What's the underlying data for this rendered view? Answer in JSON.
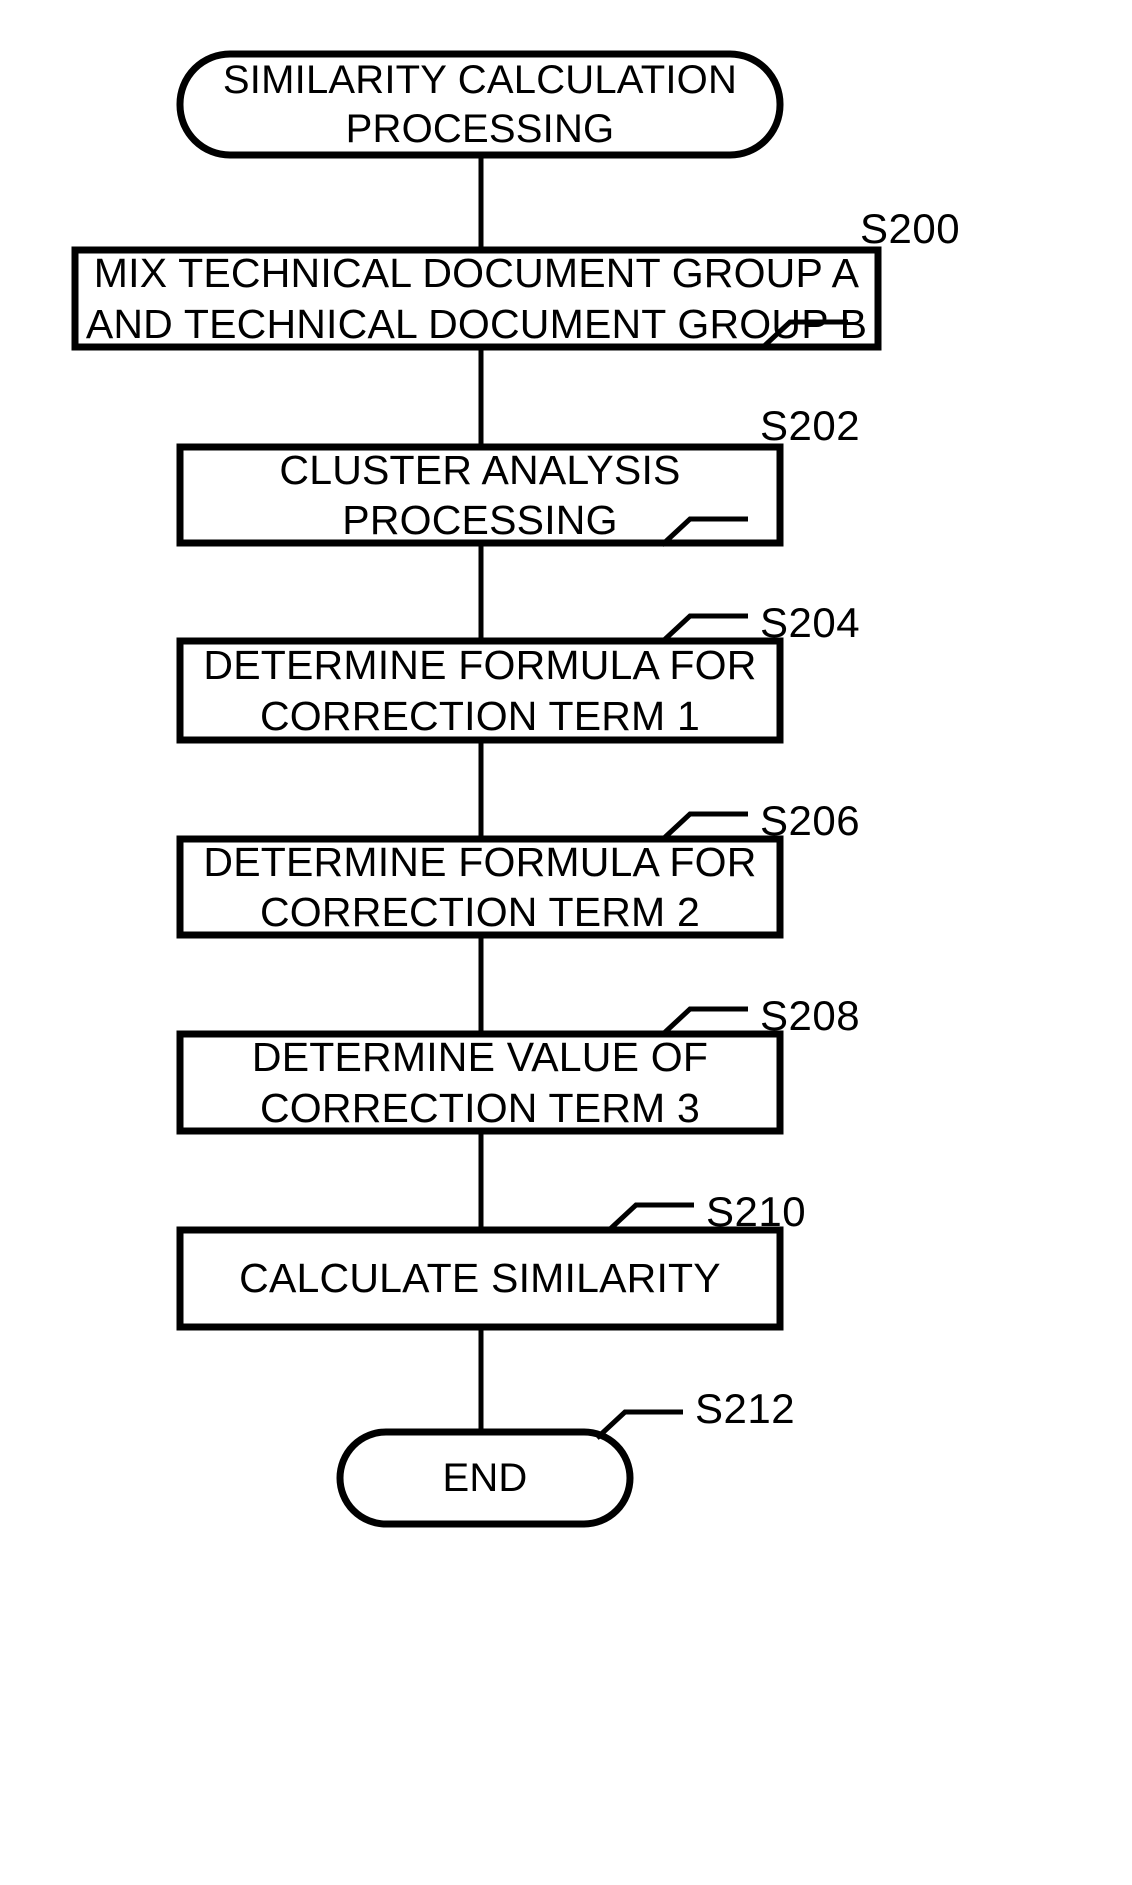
{
  "diagram": {
    "type": "flowchart",
    "orientation": "vertical",
    "nodes": {
      "start": {
        "shape": "terminator",
        "line1": "SIMILARITY CALCULATION",
        "line2": "PROCESSING"
      },
      "s200": {
        "shape": "process",
        "line1": "MIX TECHNICAL DOCUMENT GROUP A",
        "line2": "AND TECHNICAL DOCUMENT GROUP B"
      },
      "s202": {
        "shape": "process",
        "line1": "CLUSTER ANALYSIS",
        "line2": "PROCESSING"
      },
      "s204": {
        "shape": "process",
        "line1": "DETERMINE FORMULA FOR",
        "line2": "CORRECTION TERM 1"
      },
      "s206": {
        "shape": "process",
        "line1": "DETERMINE FORMULA FOR",
        "line2": "CORRECTION TERM 2"
      },
      "s208": {
        "shape": "process",
        "line1": "DETERMINE VALUE OF",
        "line2": "CORRECTION TERM 3"
      },
      "s210": {
        "shape": "process",
        "line1": "CALCULATE SIMILARITY",
        "line2": ""
      },
      "end": {
        "shape": "terminator",
        "line1": "END",
        "line2": ""
      }
    },
    "step_labels": {
      "s200": "S200",
      "s202": "S202",
      "s204": "S204",
      "s206": "S206",
      "s208": "S208",
      "s210": "S210",
      "s212": "S212"
    },
    "colors": {
      "stroke": "#000000",
      "fill": "#ffffff",
      "text": "#000000"
    }
  }
}
